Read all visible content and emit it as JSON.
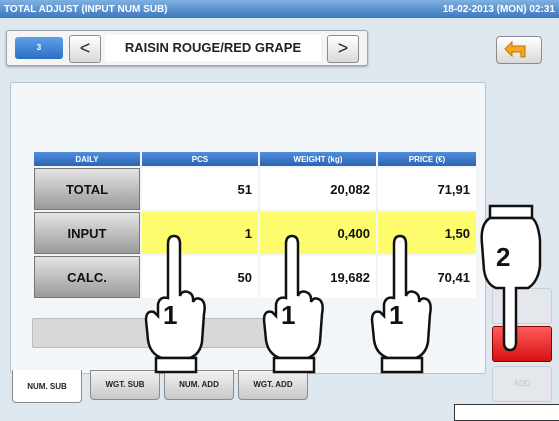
{
  "window": {
    "title": "TOTAL ADJUST (INPUT NUM SUB)",
    "datetime": "18-02-2013 (MON)  02:31"
  },
  "nav": {
    "number": "3",
    "prev_label": "<",
    "next_label": ">",
    "product_name": "RAISIN ROUGE/RED GRAPE",
    "back_icon": "return-arrow-icon"
  },
  "table": {
    "headers": [
      "DAILY",
      "PCS",
      "WEIGHT (kg)",
      "PRICE (€)"
    ],
    "rows": [
      {
        "label": "TOTAL",
        "pcs": "51",
        "weight": "20,082",
        "price": "71,91"
      },
      {
        "label": "INPUT",
        "pcs": "1",
        "weight": "0,400",
        "price": "1,50"
      },
      {
        "label": "CALC.",
        "pcs": "50",
        "weight": "19,682",
        "price": "70,41"
      }
    ]
  },
  "tabs": [
    "NUM. SUB",
    "WGT. SUB",
    "NUM. ADD",
    "WGT. ADD"
  ],
  "side": {
    "add_label": "ADD"
  },
  "annotations": {
    "step1": "1",
    "step2": "2"
  },
  "colors": {
    "accent": "#2c62b5",
    "input_highlight": "#fcfc6c",
    "confirm_red": "#e01818"
  }
}
